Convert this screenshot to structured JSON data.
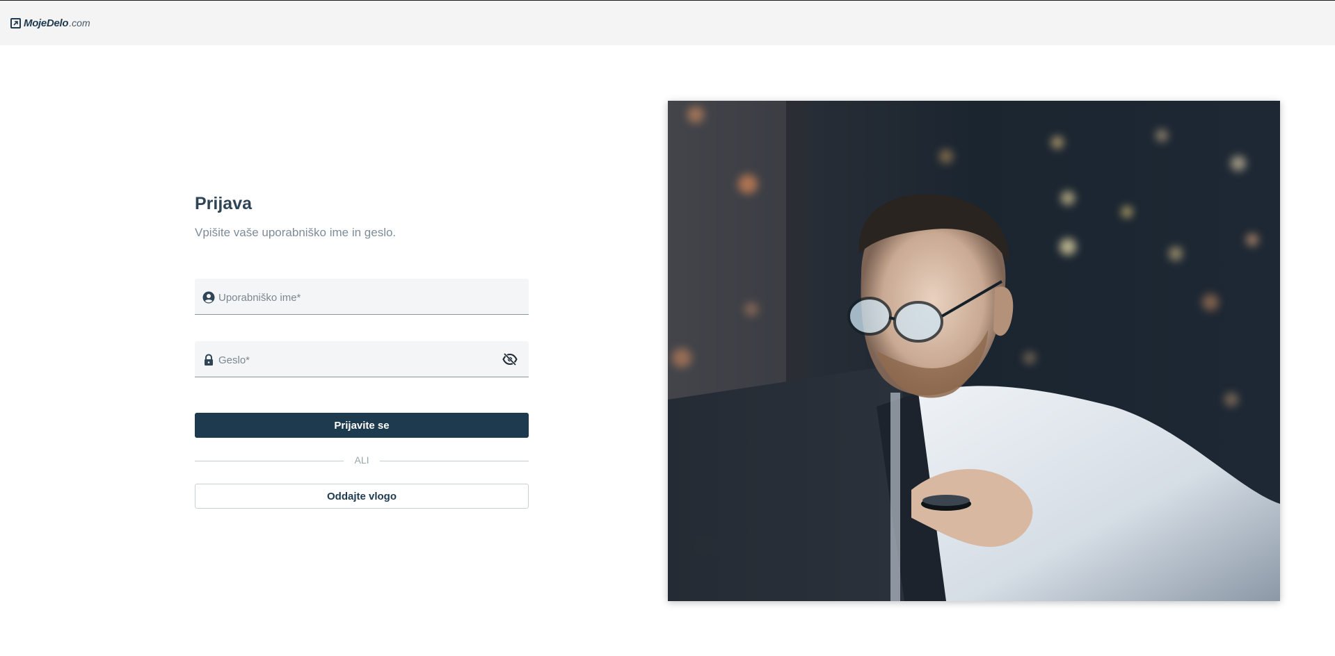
{
  "header": {
    "logo_strong": "MojeDelo",
    "logo_light": ".com"
  },
  "login": {
    "title": "Prijava",
    "subtitle": "Vpišite vaše uporabniško ime in geslo.",
    "username": {
      "placeholder": "Uporabniško ime*",
      "value": "",
      "icon": "user-circle-icon"
    },
    "password": {
      "placeholder": "Geslo*",
      "value": "",
      "icon": "lock-icon",
      "toggle_icon": "eye-off-icon"
    },
    "submit_label": "Prijavite se",
    "divider_label": "ALI",
    "apply_label": "Oddajte vlogo"
  },
  "hero": {
    "description_icon": "man-at-laptop-photo"
  },
  "colors": {
    "primary": "#1e3a4f",
    "field_bg": "#f4f5f6",
    "header_bg": "#f4f4f4",
    "muted_text": "#7d8c98"
  }
}
